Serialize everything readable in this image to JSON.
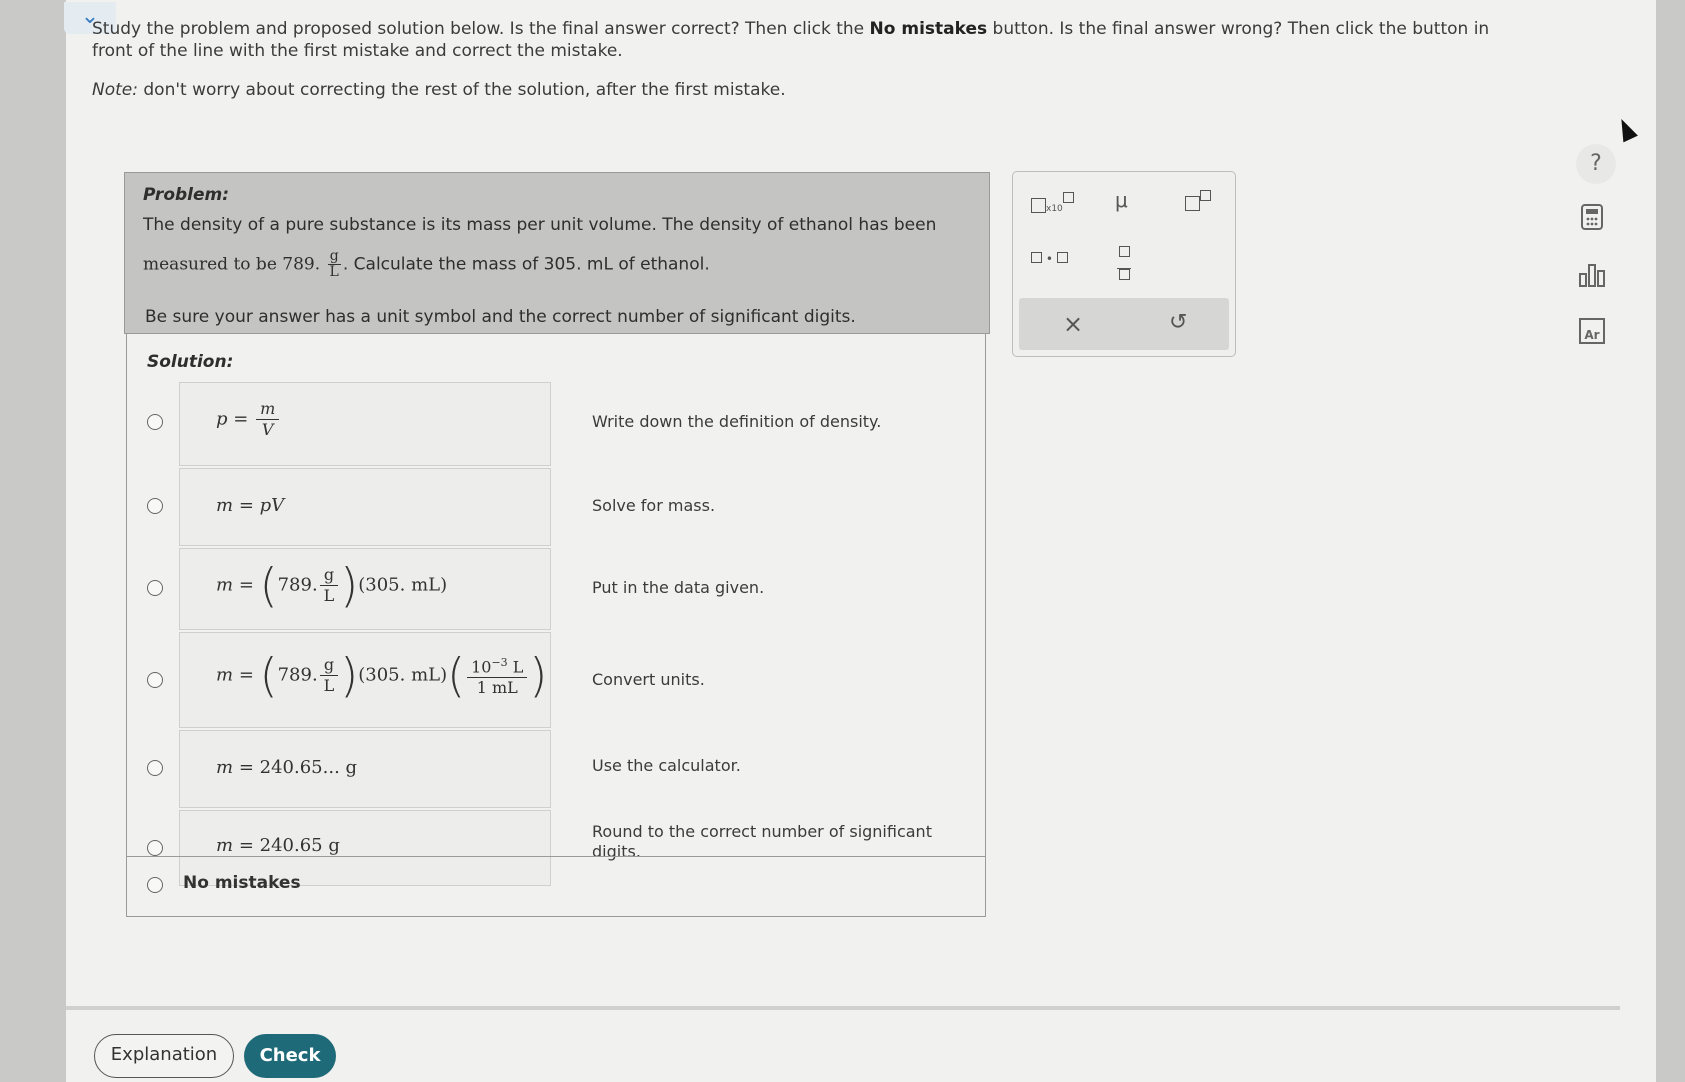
{
  "instructions": {
    "text_start": "Study the problem and proposed solution below. Is the final answer correct? Then click the ",
    "bold1": "No mistakes",
    "text_mid": " button. Is the final answer wrong? Then click the button in front of the line with the first mistake and correct the mistake.",
    "note_label": "Note:",
    "note_text": " don't worry about correcting the rest of the solution, after the first mistake."
  },
  "problem": {
    "title": "Problem:",
    "line1": "The density of a pure substance is its mass per unit volume. The density of ethanol has been",
    "line2_pre": "measured to be 789.",
    "unit_num": "g",
    "unit_den": "L",
    "line2_post": ". Calculate the mass of 305. mL of ethanol.",
    "line3": "Be sure your answer has a unit symbol and the correct number of significant digits."
  },
  "solution": {
    "title": "Solution:",
    "steps": [
      {
        "desc": "Write down the definition of density."
      },
      {
        "desc": "Solve for mass."
      },
      {
        "desc": "Put in the data given."
      },
      {
        "desc": "Convert units."
      },
      {
        "desc": "Use the calculator."
      },
      {
        "desc": "Round to the correct number of significant digits."
      }
    ],
    "eq": {
      "rho": "p",
      "m": "m",
      "V": "V",
      "equals": "=",
      "density_value": "789.",
      "g": "g",
      "L": "L",
      "volume": "305. mL",
      "conv_num": "10",
      "conv_exp": "−3",
      "conv_num_unit": "L",
      "conv_den": "1 mL",
      "calc_result": "240.65... g",
      "rounded_result": "240.65 g"
    },
    "no_mistakes": "No mistakes"
  },
  "toolbox": {
    "x10": "x10",
    "mu": "μ",
    "clear": "×",
    "undo": "↺"
  },
  "side": {
    "help": "?",
    "periodic": "Ar"
  },
  "buttons": {
    "explanation": "Explanation",
    "check": "Check"
  }
}
